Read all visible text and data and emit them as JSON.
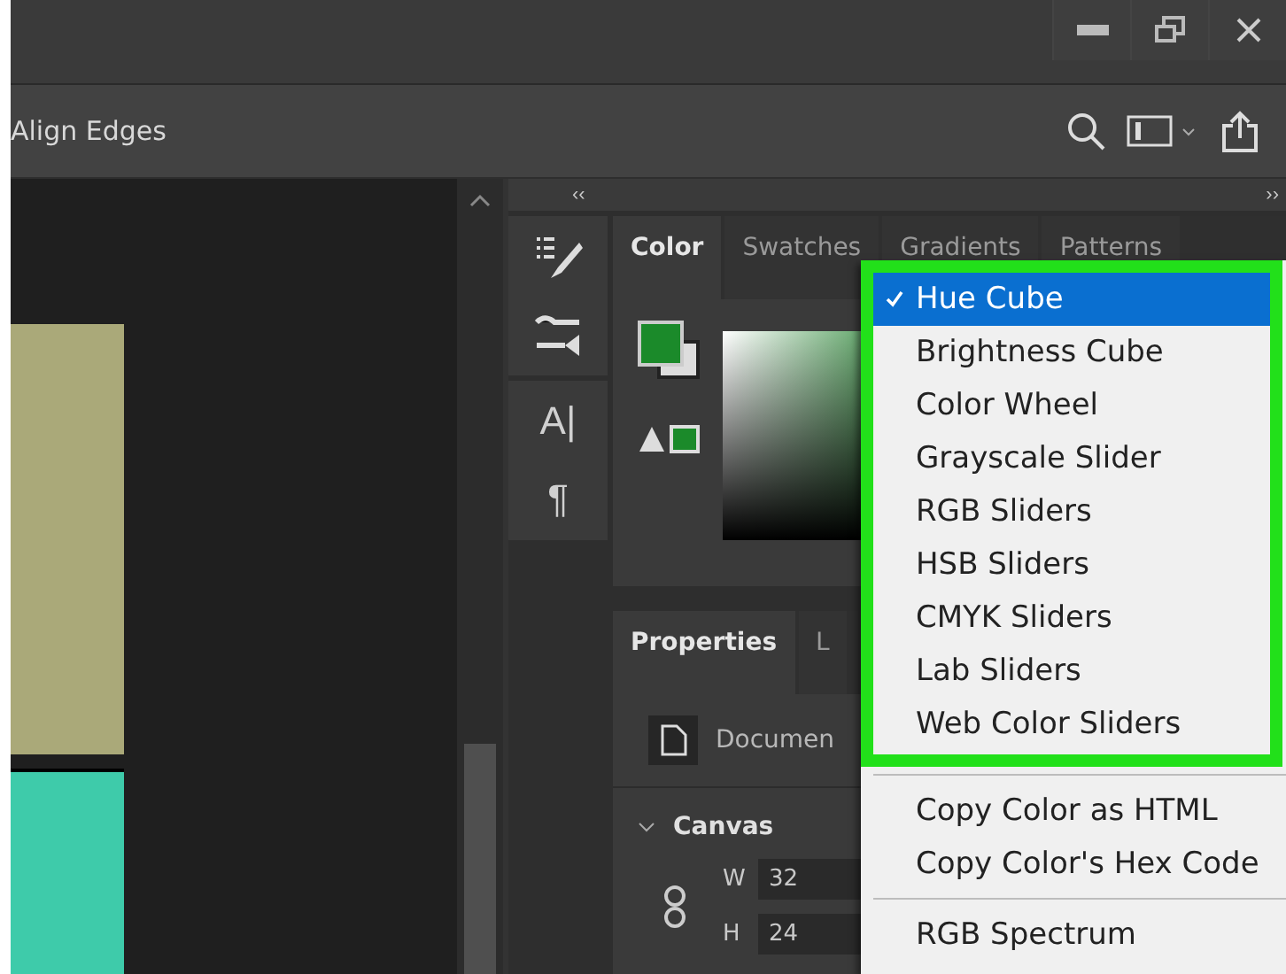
{
  "options_bar": {
    "label": "Align Edges"
  },
  "dock": {
    "collapse": "‹‹",
    "expand": "››"
  },
  "tool_column": {
    "glyphs": [
      "A|",
      "¶"
    ]
  },
  "color_panel": {
    "tabs": [
      {
        "label": "Color",
        "selected": true
      },
      {
        "label": "Swatches",
        "selected": false
      },
      {
        "label": "Gradients",
        "selected": false
      },
      {
        "label": "Patterns",
        "selected": false
      }
    ]
  },
  "properties_panel": {
    "tabs": [
      {
        "label": "Properties",
        "selected": true
      },
      {
        "label": "L",
        "selected": false
      }
    ],
    "document": "Documen",
    "section": {
      "title": "Canvas",
      "expanded": true
    },
    "fields": [
      {
        "label": "W",
        "value": "32"
      },
      {
        "label": "H",
        "value": "24"
      }
    ]
  },
  "menu": {
    "groups": [
      {
        "highlighted": true,
        "items": [
          {
            "label": "Hue Cube",
            "selected": true,
            "checked": true
          },
          {
            "label": "Brightness Cube",
            "selected": false,
            "checked": false
          },
          {
            "label": "Color Wheel",
            "selected": false,
            "checked": false
          },
          {
            "label": "Grayscale Slider",
            "selected": false,
            "checked": false
          },
          {
            "label": "RGB Sliders",
            "selected": false,
            "checked": false
          },
          {
            "label": "HSB Sliders",
            "selected": false,
            "checked": false
          },
          {
            "label": "CMYK Sliders",
            "selected": false,
            "checked": false
          },
          {
            "label": "Lab Sliders",
            "selected": false,
            "checked": false
          },
          {
            "label": "Web Color Sliders",
            "selected": false,
            "checked": false
          }
        ]
      },
      {
        "highlighted": false,
        "items": [
          {
            "label": "Copy Color as HTML",
            "selected": false,
            "checked": false
          },
          {
            "label": "Copy Color's Hex Code",
            "selected": false,
            "checked": false
          }
        ]
      },
      {
        "highlighted": false,
        "items": [
          {
            "label": "RGB Spectrum",
            "selected": false,
            "checked": false
          }
        ]
      }
    ]
  }
}
